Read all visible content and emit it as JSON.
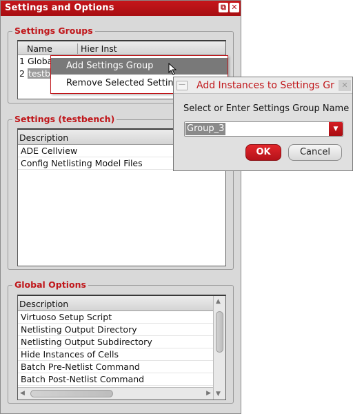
{
  "window": {
    "title": "Settings and Options"
  },
  "settings_groups": {
    "title": "Settings Groups",
    "columns": [
      "Name",
      "Hier Inst"
    ],
    "rows": [
      {
        "index": "1",
        "name": "Globa"
      },
      {
        "index": "2",
        "name": "testb"
      }
    ]
  },
  "context_menu": {
    "items": [
      "Add Settings Group",
      "Remove Selected Setting"
    ]
  },
  "settings_testbench": {
    "title": "Settings (testbench)",
    "column": "Description",
    "rows": [
      "ADE Cellview",
      "Config Netlisting Model Files"
    ]
  },
  "global_options": {
    "title": "Global Options",
    "column": "Description",
    "rows": [
      "Virtuoso Setup Script",
      "Netlisting Output Directory",
      "Netlisting Output Subdirectory",
      "Hide Instances of Cells",
      "Batch Pre-Netlist Command",
      "Batch Post-Netlist Command"
    ]
  },
  "dialog": {
    "title": "Add Instances to Settings Gr",
    "label": "Select or Enter Settings Group Name",
    "value": "Group_3",
    "ok_label": "OK",
    "cancel_label": "Cancel"
  },
  "colors": {
    "accent": "#c0161a",
    "titlebar": "#b0121a"
  }
}
